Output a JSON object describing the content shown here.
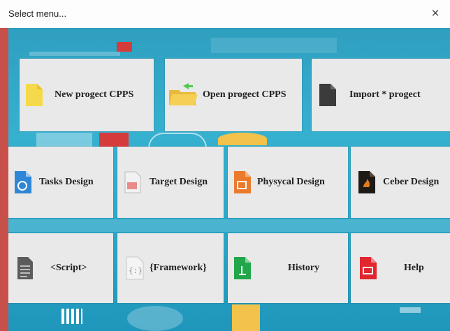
{
  "window": {
    "title": "Select menu...",
    "close_glyph": "×"
  },
  "colors": {
    "tile_bg": "#e9e9e9",
    "background": "#2fa5c5",
    "accent_left": "#c8504a"
  },
  "tiles": [
    {
      "id": "new-project",
      "label": "New progect CPPS",
      "icon": "yellow-file-icon"
    },
    {
      "id": "open-project",
      "label": "Open progect CPPS",
      "icon": "open-folder-icon"
    },
    {
      "id": "import-project",
      "label": "Import * progect",
      "icon": "dark-file-icon"
    },
    {
      "id": "tasks-design",
      "label": "Tasks Design",
      "icon": "blue-document-icon"
    },
    {
      "id": "target-design",
      "label": "Target Design",
      "icon": "gray-document-icon"
    },
    {
      "id": "physical-design",
      "label": "Physycal Design",
      "icon": "orange-document-icon"
    },
    {
      "id": "ceber-design",
      "label": "Ceber Design",
      "icon": "black-document-icon"
    },
    {
      "id": "script",
      "label": "<Script>",
      "icon": "script-file-icon"
    },
    {
      "id": "framework",
      "label": "{Framework}",
      "icon": "braces-file-icon"
    },
    {
      "id": "history",
      "label": "History",
      "icon": "green-document-icon"
    },
    {
      "id": "help",
      "label": "Help",
      "icon": "red-document-icon"
    }
  ]
}
